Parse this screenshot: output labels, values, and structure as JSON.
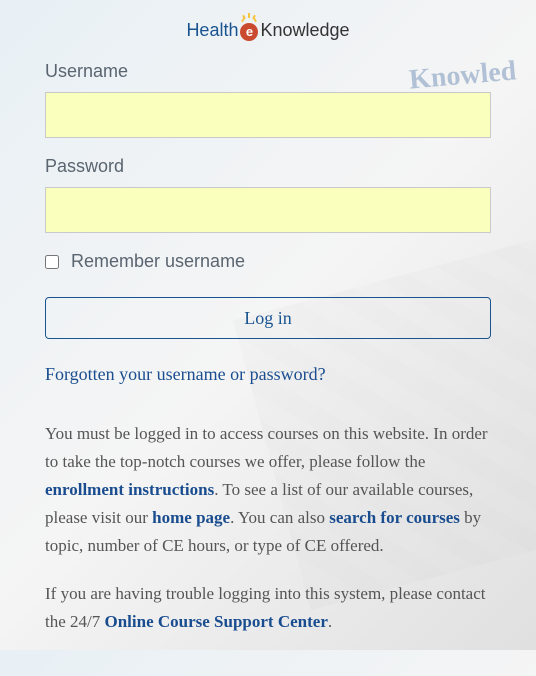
{
  "logo": {
    "part1": "Health",
    "e": "e",
    "part2": "Knowledge"
  },
  "form": {
    "username_label": "Username",
    "password_label": "Password",
    "remember_label": "Remember username",
    "login_button": "Log in"
  },
  "forgot_link": "Forgotten your username or password?",
  "paragraph1": {
    "t1": "You must be logged in to access courses on this website. In order to take the top-notch courses we offer, please follow the ",
    "link1": "enrollment instructions",
    "t2": ". To see a list of our available courses, please visit our ",
    "link2": "home page",
    "t3": ". You can also ",
    "link3": "search for courses",
    "t4": " by topic, number of CE hours, or type of CE offered."
  },
  "paragraph2": {
    "t1": "If you are having trouble logging into this system, please contact the 24/7 ",
    "link1": "Online Course Support Center",
    "t2": "."
  },
  "bg_text": "Knowled"
}
